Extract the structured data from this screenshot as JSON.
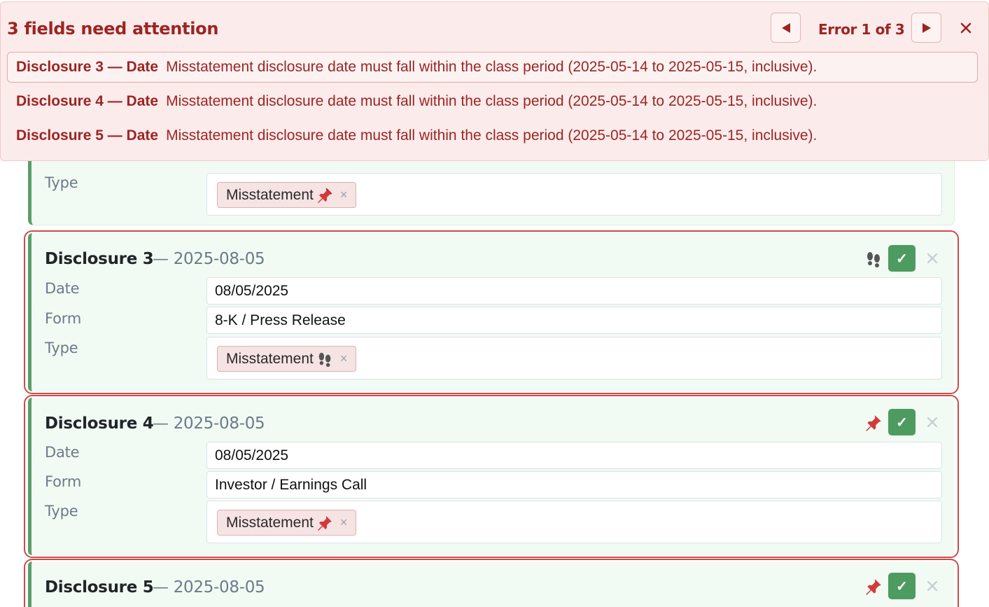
{
  "banner": {
    "title": "3 fields need attention",
    "counter": "Error 1 of 3",
    "errors": [
      {
        "label": "Disclosure 3 — Date",
        "message": "Misstatement disclosure date must fall within the class period (2025-05-14 to 2025-05-15, inclusive)."
      },
      {
        "label": "Disclosure 4 — Date",
        "message": "Misstatement disclosure date must fall within the class period (2025-05-14 to 2025-05-15, inclusive)."
      },
      {
        "label": "Disclosure 5 — Date",
        "message": "Misstatement disclosure date must fall within the class period (2025-05-14 to 2025-05-15, inclusive)."
      }
    ],
    "colors": {
      "text": "#9b2523",
      "background": "#fcebeb"
    }
  },
  "labels": {
    "date": "Date",
    "form": "Form",
    "type": "Type"
  },
  "partial_card": {
    "type_tag": "Misstatement",
    "type_icon": "pushpin-icon"
  },
  "disclosures": [
    {
      "title": "Disclosure 3",
      "date_suffix": "— 2025-08-05",
      "date_value": "08/05/2025",
      "form_value": "8-K / Press Release",
      "type_tag": "Misstatement",
      "source_icon": "footprints-icon"
    },
    {
      "title": "Disclosure 4",
      "date_suffix": "— 2025-08-05",
      "date_value": "08/05/2025",
      "form_value": "Investor / Earnings Call",
      "type_tag": "Misstatement",
      "source_icon": "pushpin-icon"
    },
    {
      "title": "Disclosure 5",
      "date_suffix": "— 2025-08-05",
      "source_icon": "pushpin-icon"
    }
  ],
  "icons": {
    "check": "✓",
    "close": "×"
  },
  "colors": {
    "accent_green": "#4e9b62",
    "error_red": "#cc4b49",
    "card_bg": "#f2fbf3"
  }
}
